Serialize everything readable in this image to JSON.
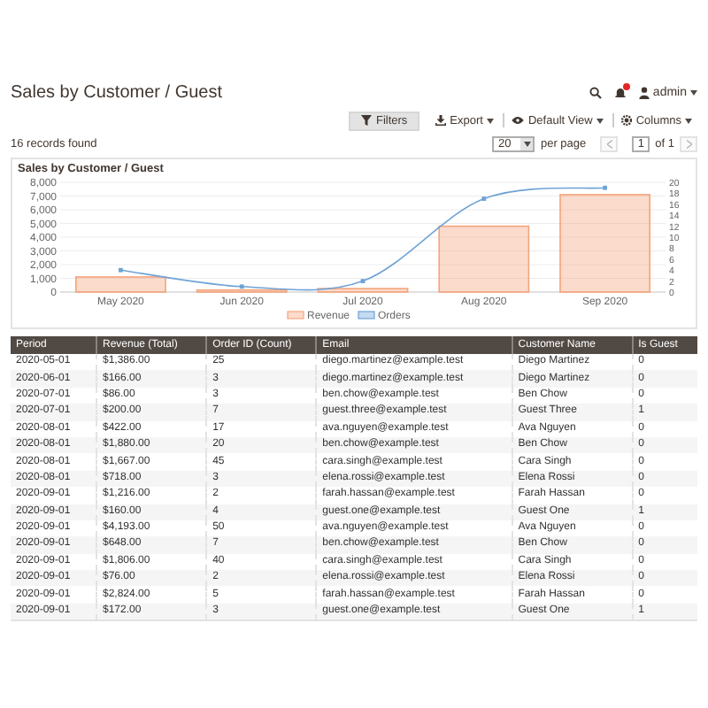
{
  "page_title": "Sales by Customer / Guest",
  "user": {
    "name": "admin"
  },
  "toolbar": [
    {
      "kind": "filters",
      "label": "Filters"
    },
    {
      "kind": "export",
      "label": "Export"
    },
    {
      "kind": "view",
      "label": "Default View"
    },
    {
      "kind": "columns",
      "label": "Columns"
    }
  ],
  "records_found": "16 records found",
  "pager": {
    "per_page": "20",
    "per_page_label": "per page",
    "page": "1",
    "of": "of 1"
  },
  "chart": {
    "title": "Sales by Customer / Guest",
    "chart_data": {
      "type": "bar",
      "grid": true,
      "legend": "bottom",
      "categories": [
        "May 2020",
        "Jun 2020",
        "Jul 2020",
        "Aug 2020",
        "Sep 2020"
      ],
      "series": [
        {
          "name": "Revenue",
          "type": "bar",
          "color": "#f5a47c",
          "values": [
            1100,
            150,
            250,
            4800,
            7100
          ]
        },
        {
          "name": "Orders",
          "type": "line",
          "axis": "y2",
          "marker": "square",
          "color": "#6fa3d6",
          "values": [
            4,
            1,
            2,
            17,
            19
          ]
        }
      ],
      "ylim": [
        0,
        8000
      ],
      "yticks": [
        0,
        {
          "value": 1000,
          "label": "1,000"
        },
        {
          "value": 2000,
          "label": "2,000"
        },
        {
          "value": 3000,
          "label": "3,000"
        },
        {
          "value": 4000,
          "label": "4,000"
        },
        {
          "value": 5000,
          "label": "5,000"
        },
        {
          "value": 6000,
          "label": "6,000"
        },
        {
          "value": 7000,
          "label": "7,000"
        },
        {
          "value": 8000,
          "label": "8,000"
        }
      ],
      "y2lim": [
        0,
        20
      ],
      "y2ticks": [
        0,
        2,
        4,
        6,
        8,
        10,
        12,
        14,
        16,
        18,
        20
      ]
    }
  },
  "table": {
    "columns": [
      "Period",
      "Revenue (Total)",
      "Order ID (Count)",
      "Email",
      "Customer Name",
      "Is Guest"
    ],
    "rows": [
      [
        "2020-05-01",
        "$1,386.00",
        "25",
        "diego.martinez@example.test",
        "Diego Martinez",
        "0"
      ],
      [
        "2020-06-01",
        "$166.00",
        "3",
        "diego.martinez@example.test",
        "Diego Martinez",
        "0"
      ],
      [
        "2020-07-01",
        "$86.00",
        "3",
        "ben.chow@example.test",
        "Ben Chow",
        "0"
      ],
      [
        "2020-07-01",
        "$200.00",
        "7",
        "guest.three@example.test",
        "Guest Three",
        "1"
      ],
      [
        "2020-08-01",
        "$422.00",
        "17",
        "ava.nguyen@example.test",
        "Ava Nguyen",
        "0"
      ],
      [
        "2020-08-01",
        "$1,880.00",
        "20",
        "ben.chow@example.test",
        "Ben Chow",
        "0"
      ],
      [
        "2020-08-01",
        "$1,667.00",
        "45",
        "cara.singh@example.test",
        "Cara Singh",
        "0"
      ],
      [
        "2020-08-01",
        "$718.00",
        "3",
        "elena.rossi@example.test",
        "Elena Rossi",
        "0"
      ],
      [
        "2020-09-01",
        "$1,216.00",
        "2",
        "farah.hassan@example.test",
        "Farah Hassan",
        "0"
      ],
      [
        "2020-09-01",
        "$160.00",
        "4",
        "guest.one@example.test",
        "Guest One",
        "1"
      ],
      [
        "2020-09-01",
        "$4,193.00",
        "50",
        "ava.nguyen@example.test",
        "Ava Nguyen",
        "0"
      ],
      [
        "2020-09-01",
        "$648.00",
        "7",
        "ben.chow@example.test",
        "Ben Chow",
        "0"
      ],
      [
        "2020-09-01",
        "$1,806.00",
        "40",
        "cara.singh@example.test",
        "Cara Singh",
        "0"
      ],
      [
        "2020-09-01",
        "$76.00",
        "2",
        "elena.rossi@example.test",
        "Elena Rossi",
        "0"
      ],
      [
        "2020-09-01",
        "$2,824.00",
        "5",
        "farah.hassan@example.test",
        "Farah Hassan",
        "0"
      ],
      [
        "2020-09-01",
        "$172.00",
        "3",
        "guest.one@example.test",
        "Guest One",
        "1"
      ]
    ]
  }
}
